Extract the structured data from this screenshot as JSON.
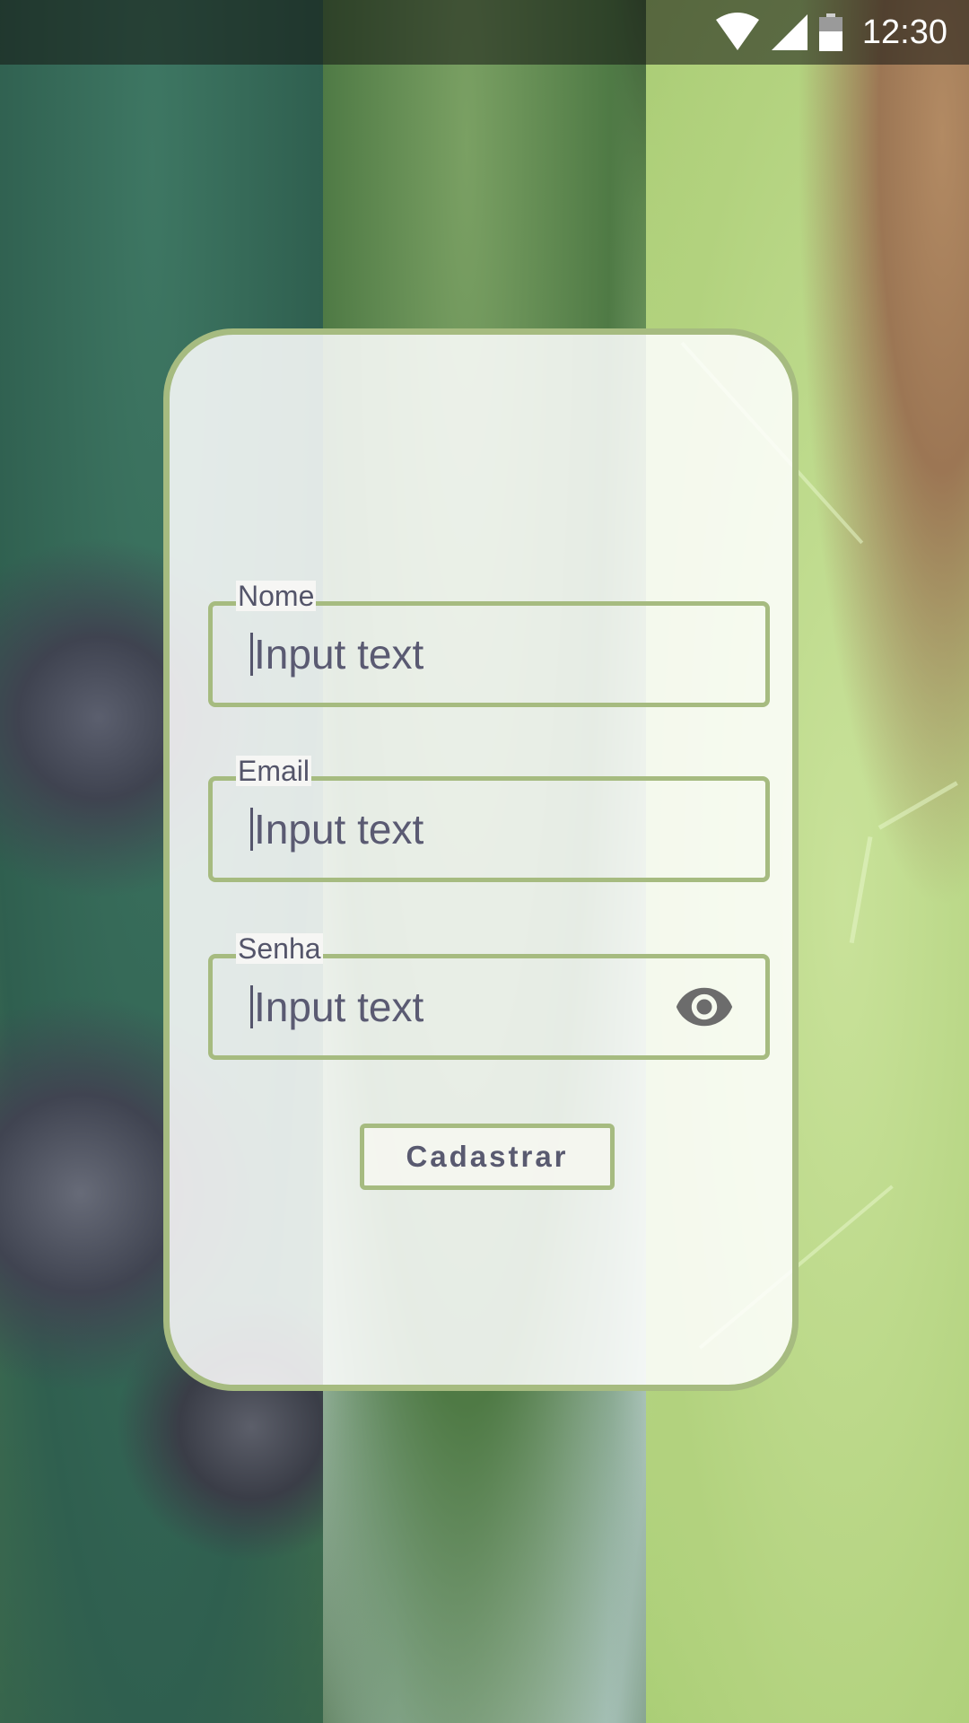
{
  "status_bar": {
    "time": "12:30",
    "icons": [
      "wifi-icon",
      "cell-signal-icon",
      "battery-icon"
    ],
    "background": "#1e201c"
  },
  "form": {
    "fields": [
      {
        "label": "Nome",
        "value": "Input text"
      },
      {
        "label": "Email",
        "value": "Input text"
      },
      {
        "label": "Senha",
        "value": "Input text",
        "trailing_icon": "eye-icon"
      }
    ],
    "submit_label": "Cadastrar"
  },
  "colors": {
    "accent": "#a6bb80",
    "text": "#54556a",
    "card_background": "#f6f6f4"
  }
}
